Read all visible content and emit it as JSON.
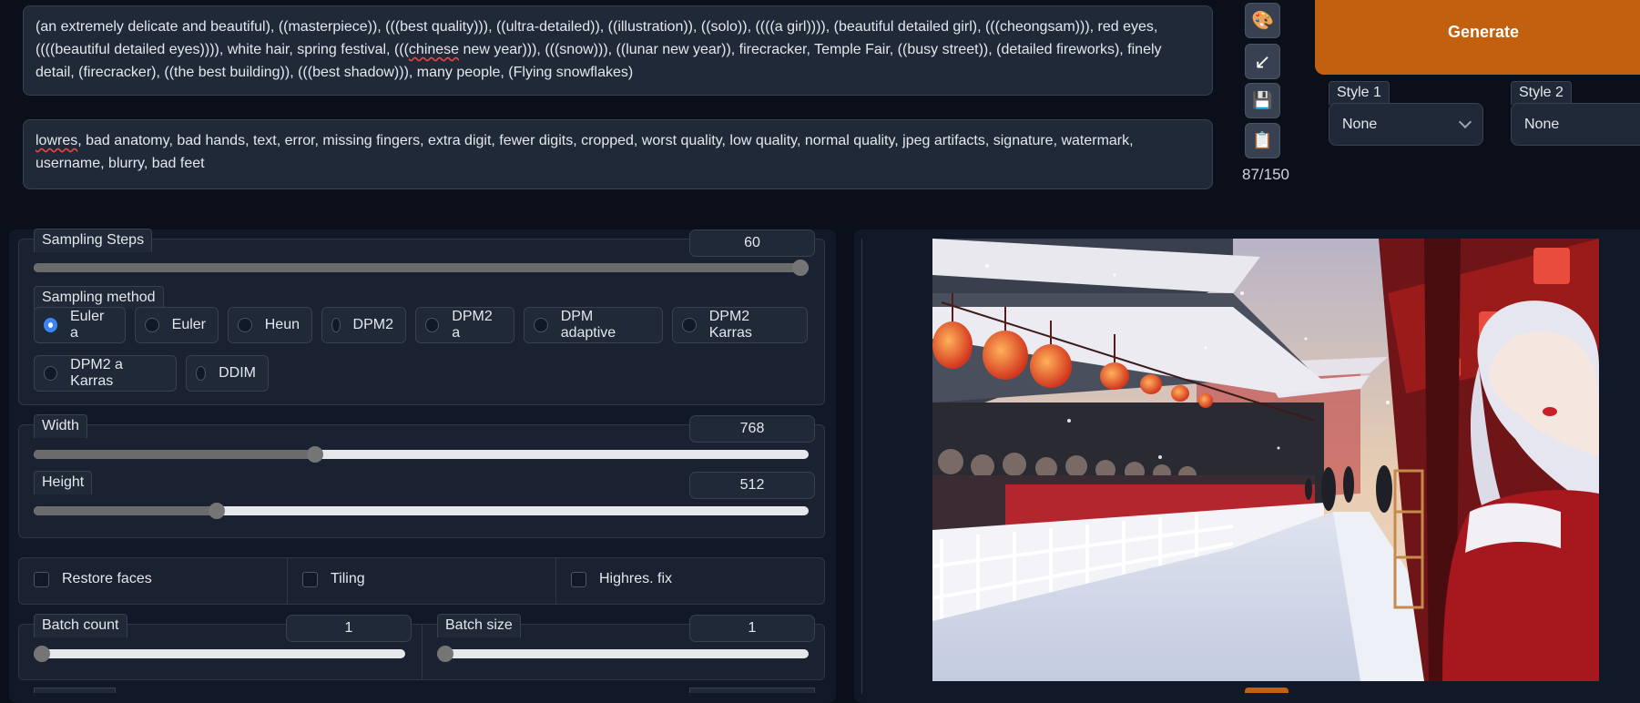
{
  "prompt": {
    "positive_segments": [
      {
        "text": "(an extremely delicate and beautiful), ((masterpiece)), (((best quality))), ((ultra-detailed)), ((illustration)), ((solo)), ((((a girl)))), (beautiful detailed girl), (((cheongsam))), red eyes, ((((beautiful detailed eyes)))), white hair, spring festival, ((("
      },
      {
        "text": "chinese",
        "spell": true
      },
      {
        "text": " new year))), (((snow))), ((lunar new year)), firecracker, Temple Fair, ((busy street)), (detailed fireworks), finely detail, (firecracker), ((the best building)), (((best shadow))), many people, (Flying snowflakes)"
      }
    ],
    "negative_segments": [
      {
        "text": "lowres",
        "spell": true
      },
      {
        "text": ", bad anatomy, bad hands, text, error, missing fingers, extra digit, fewer digits, cropped, worst quality, low quality, normal quality, jpeg artifacts, signature, watermark, username, blurry, bad feet"
      }
    ],
    "token_count": "87/150"
  },
  "tools": [
    {
      "name": "palette-icon",
      "glyph": "🎨"
    },
    {
      "name": "arrow-down-left-icon",
      "glyph": "↙"
    },
    {
      "name": "save-icon",
      "glyph": "💾"
    },
    {
      "name": "clipboard-icon",
      "glyph": "📋"
    }
  ],
  "generate_label": "Generate",
  "styles": [
    {
      "label": "Style 1",
      "value": "None"
    },
    {
      "label": "Style 2",
      "value": "None"
    }
  ],
  "sampling_steps": {
    "label": "Sampling Steps",
    "value": "60",
    "fraction": 1.0
  },
  "sampling_method": {
    "label": "Sampling method",
    "options": [
      "Euler a",
      "Euler",
      "Heun",
      "DPM2",
      "DPM2 a",
      "DPM adaptive",
      "DPM2 Karras",
      "DPM2 a Karras",
      "DDIM"
    ],
    "selected": "Euler a"
  },
  "width": {
    "label": "Width",
    "value": "768",
    "fraction": 0.36
  },
  "height": {
    "label": "Height",
    "value": "512",
    "fraction": 0.23
  },
  "checkboxes": [
    {
      "label": "Restore faces",
      "checked": false
    },
    {
      "label": "Tiling",
      "checked": false
    },
    {
      "label": "Highres. fix",
      "checked": false
    }
  ],
  "batch_count": {
    "label": "Batch count",
    "value": "1",
    "fraction": 0.0
  },
  "batch_size": {
    "label": "Batch size",
    "value": "1",
    "fraction": 0.0
  },
  "colors": {
    "accent": "#c2600f",
    "radio_selected": "#3b82f6",
    "background": "#0b0f19"
  }
}
